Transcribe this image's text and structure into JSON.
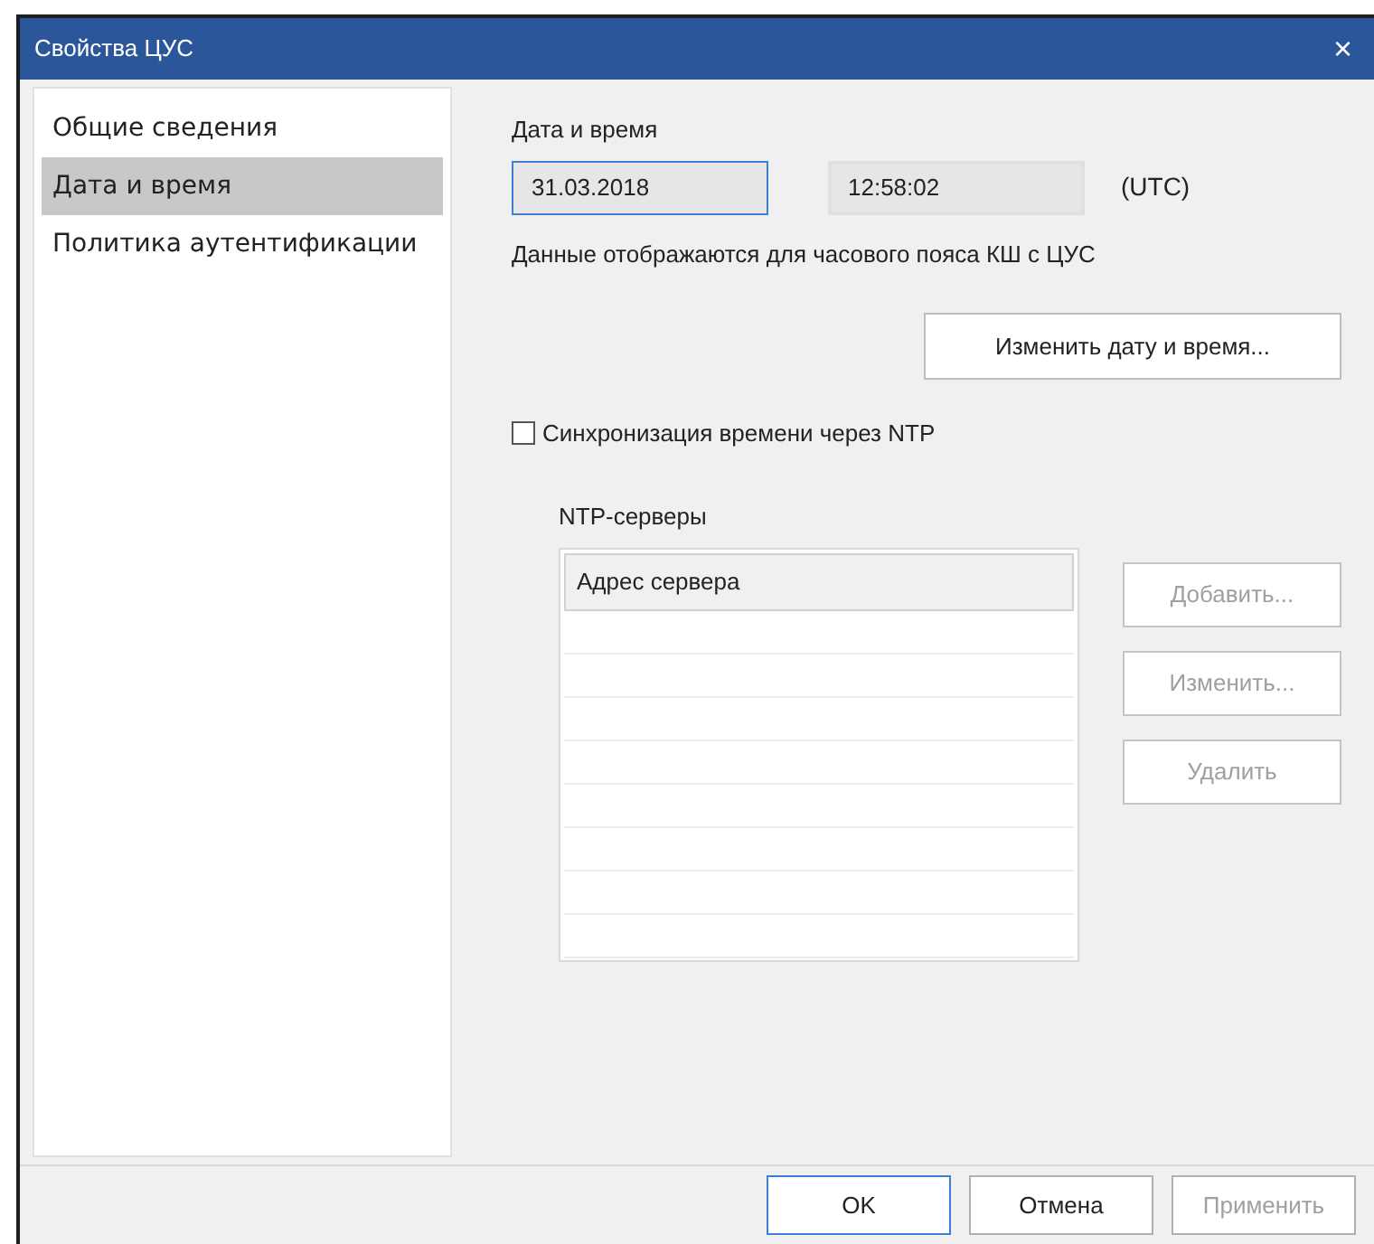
{
  "window": {
    "title": "Свойства ЦУС",
    "close": "×"
  },
  "sidebar": {
    "items": [
      {
        "label": "Общие сведения",
        "selected": false
      },
      {
        "label": "Дата и время",
        "selected": true
      },
      {
        "label": "Политика аутентификации",
        "selected": false
      }
    ]
  },
  "datetime": {
    "heading": "Дата и время",
    "date": "31.03.2018",
    "date_focused": true,
    "time": "12:58:02",
    "timezone": "(UTC)",
    "note": "Данные отображаются для часового пояса КШ с ЦУС",
    "change_button": "Изменить дату и время..."
  },
  "ntp": {
    "checkbox": {
      "label": "Синхронизация времени через NTP",
      "checked": false
    },
    "heading": "NTP-серверы",
    "column": "Адрес сервера",
    "buttons": [
      {
        "label": "Добавить...",
        "disabled": true
      },
      {
        "label": "Изменить...",
        "disabled": true
      },
      {
        "label": "Удалить",
        "disabled": true
      }
    ]
  },
  "footer": {
    "buttons": [
      {
        "label": "OK",
        "disabled": false,
        "default": true
      },
      {
        "label": "Отмена",
        "disabled": false,
        "default": false
      },
      {
        "label": "Применить",
        "disabled": true,
        "default": false
      }
    ]
  }
}
